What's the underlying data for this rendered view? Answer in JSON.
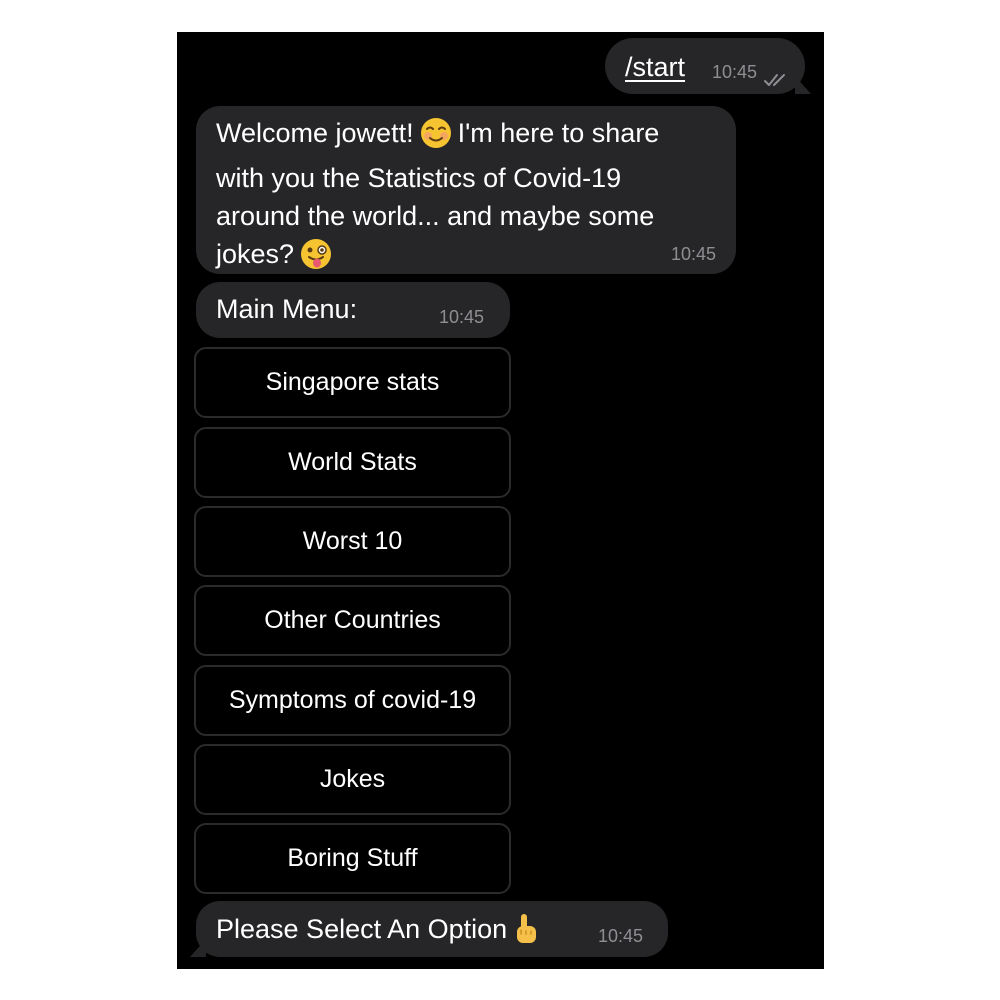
{
  "messages": {
    "start": {
      "text": "/start",
      "time": "10:45"
    },
    "welcome": {
      "line1_a": "Welcome jowett!",
      "line1_b": "I'm here to share",
      "line2": "with you the Statistics of Covid-19",
      "line3": "around the world... and maybe some",
      "line4": "jokes?",
      "emoji1": "smiling-face-icon",
      "emoji2": "winking-face-with-tongue-icon",
      "time": "10:45"
    },
    "menu": {
      "text": "Main Menu:",
      "time": "10:45"
    },
    "select": {
      "text": "Please Select An Option",
      "emoji": "pointing-up-icon",
      "time": "10:45"
    }
  },
  "keyboard": {
    "buttons": [
      "Singapore stats",
      "World Stats",
      "Worst 10",
      "Other Countries",
      "Symptoms of covid-19",
      "Jokes",
      "Boring Stuff"
    ]
  },
  "colors": {
    "background": "#000000",
    "bubble": "#262628",
    "text": "#ffffff",
    "timestamp": "#8e8e93",
    "button_border": "#2b2b2d"
  }
}
